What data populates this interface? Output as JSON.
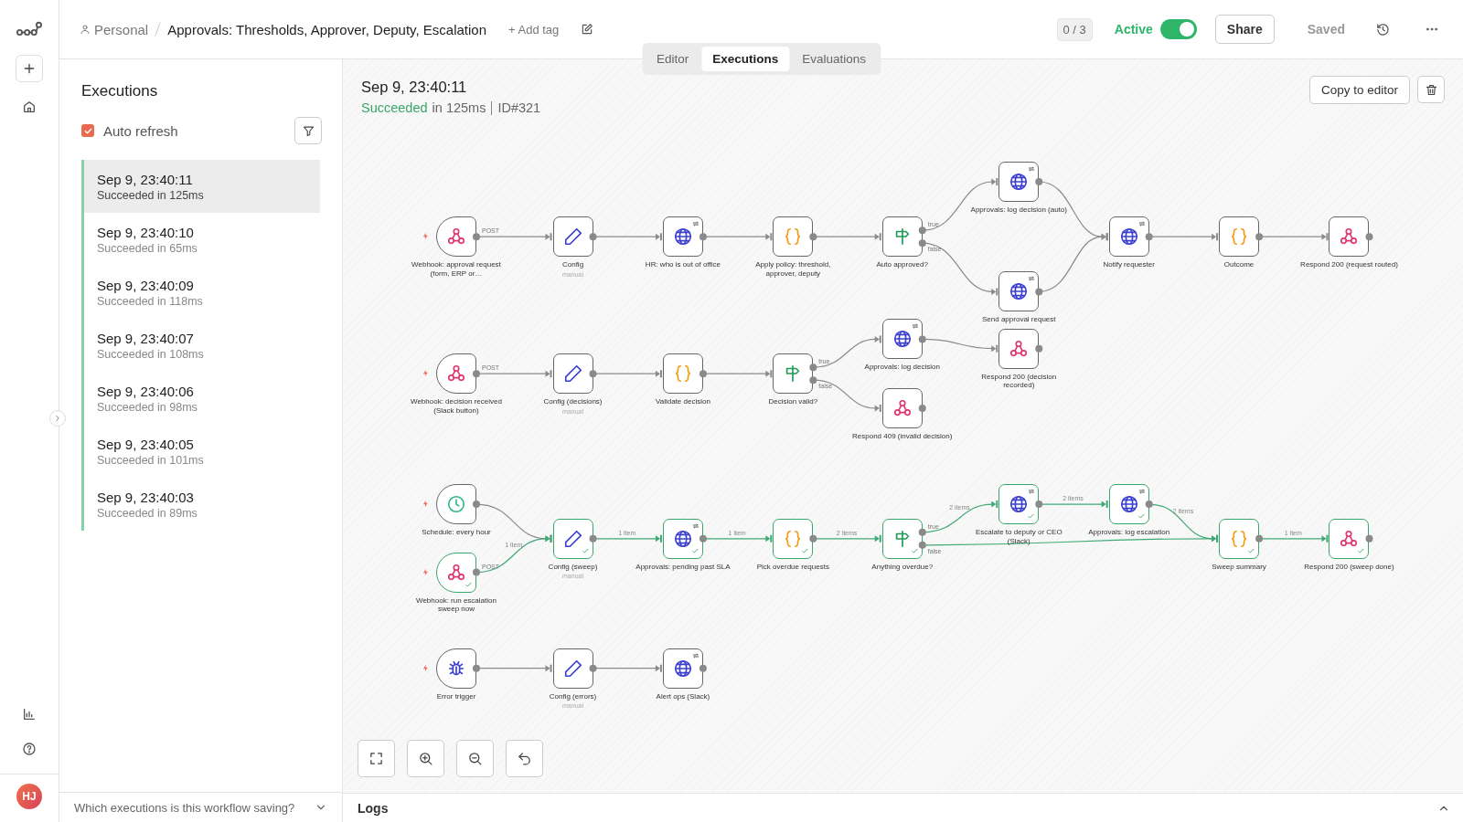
{
  "rail": {
    "avatar": "HJ"
  },
  "header": {
    "breadcrumb": "Personal",
    "title": "Approvals: Thresholds, Approver, Deputy, Escalation",
    "add_tag": "+ Add tag",
    "counter": "0 / 3",
    "active_label": "Active",
    "active": true,
    "share": "Share",
    "saved": "Saved"
  },
  "tabs": [
    {
      "label": "Editor",
      "selected": false
    },
    {
      "label": "Executions",
      "selected": true
    },
    {
      "label": "Evaluations",
      "selected": false
    }
  ],
  "sidebar": {
    "title": "Executions",
    "auto_refresh": {
      "label": "Auto refresh",
      "checked": true
    },
    "executions": [
      {
        "time": "Sep 9, 23:40:11",
        "status": "Succeeded in 125ms",
        "selected": true
      },
      {
        "time": "Sep 9, 23:40:10",
        "status": "Succeeded in 65ms",
        "selected": false
      },
      {
        "time": "Sep 9, 23:40:09",
        "status": "Succeeded in 118ms",
        "selected": false
      },
      {
        "time": "Sep 9, 23:40:07",
        "status": "Succeeded in 108ms",
        "selected": false
      },
      {
        "time": "Sep 9, 23:40:06",
        "status": "Succeeded in 98ms",
        "selected": false
      },
      {
        "time": "Sep 9, 23:40:05",
        "status": "Succeeded in 101ms",
        "selected": false
      },
      {
        "time": "Sep 9, 23:40:03",
        "status": "Succeeded in 89ms",
        "selected": false
      }
    ],
    "footer": "Which executions is this workflow saving?"
  },
  "execution": {
    "time": "Sep 9, 23:40:11",
    "status": "Succeeded",
    "duration": "in 125ms",
    "id": "ID#321",
    "copy_button": "Copy to editor"
  },
  "canvas": {
    "nodes": [
      {
        "name": "Webhook: approval request (form, ERP or…",
        "kind": "webhook",
        "trigger": true,
        "outputs": [
          {
            "label": "POST"
          }
        ],
        "executed": false
      },
      {
        "name": "Config",
        "subtitle": "manual",
        "kind": "set",
        "trigger": false,
        "executed": false
      },
      {
        "name": "HR: who is out of office",
        "kind": "http",
        "trigger": false,
        "executed": false
      },
      {
        "name": "Apply policy: threshold, approver, deputy",
        "kind": "code",
        "trigger": false,
        "executed": false
      },
      {
        "name": "Auto approved?",
        "kind": "if",
        "trigger": false,
        "outputs": [
          {
            "label": "true"
          },
          {
            "label": "false"
          }
        ],
        "executed": false
      },
      {
        "name": "Approvals: log decision (auto)",
        "kind": "http",
        "trigger": false,
        "executed": false
      },
      {
        "name": "Send approval request",
        "kind": "http",
        "trigger": false,
        "executed": false
      },
      {
        "name": "Notify requester",
        "kind": "http",
        "trigger": false,
        "executed": false
      },
      {
        "name": "Outcome",
        "kind": "code",
        "trigger": false,
        "executed": false
      },
      {
        "name": "Respond 200 (request routed)",
        "kind": "webhook",
        "trigger": false,
        "executed": false
      },
      {
        "name": "Webhook: decision received (Slack button)",
        "kind": "webhook",
        "trigger": true,
        "outputs": [
          {
            "label": "POST"
          }
        ],
        "executed": false
      },
      {
        "name": "Config (decisions)",
        "subtitle": "manual",
        "kind": "set",
        "trigger": false,
        "executed": false
      },
      {
        "name": "Validate decision",
        "kind": "code",
        "trigger": false,
        "executed": false
      },
      {
        "name": "Decision valid?",
        "kind": "if",
        "trigger": false,
        "outputs": [
          {
            "label": "true"
          },
          {
            "label": "false"
          }
        ],
        "executed": false
      },
      {
        "name": "Approvals: log decision",
        "kind": "http",
        "trigger": false,
        "executed": false
      },
      {
        "name": "Respond 200 (decision recorded)",
        "kind": "webhook",
        "trigger": false,
        "executed": false
      },
      {
        "name": "Respond 409 (invalid decision)",
        "kind": "webhook",
        "trigger": false,
        "executed": false
      },
      {
        "name": "Schedule: every hour",
        "kind": "schedule",
        "trigger": true,
        "executed": false
      },
      {
        "name": "Webhook: run escalation sweep now",
        "kind": "webhook",
        "trigger": true,
        "outputs": [
          {
            "label": "POST",
            "items": "1 item"
          }
        ],
        "executed": true
      },
      {
        "name": "Config (sweep)",
        "subtitle": "manual",
        "kind": "set",
        "trigger": false,
        "outputs": [
          {
            "items": "1 item"
          }
        ],
        "executed": true
      },
      {
        "name": "Approvals: pending past SLA",
        "kind": "http",
        "trigger": false,
        "outputs": [
          {
            "items": "1 item"
          }
        ],
        "executed": true
      },
      {
        "name": "Pick overdue requests",
        "kind": "code",
        "trigger": false,
        "outputs": [
          {
            "items": "2 items"
          }
        ],
        "executed": true
      },
      {
        "name": "Anything overdue?",
        "kind": "if",
        "trigger": false,
        "outputs": [
          {
            "label": "true",
            "items": "2 items"
          },
          {
            "label": "false"
          }
        ],
        "executed": true
      },
      {
        "name": "Escalate to deputy or CEO (Slack)",
        "kind": "http",
        "trigger": false,
        "outputs": [
          {
            "items": "2 items"
          }
        ],
        "executed": true
      },
      {
        "name": "Approvals: log escalation",
        "kind": "http",
        "trigger": false,
        "outputs": [
          {
            "items": "2 items"
          }
        ],
        "executed": true
      },
      {
        "name": "Sweep summary",
        "kind": "code",
        "trigger": false,
        "outputs": [
          {
            "items": "1 item"
          }
        ],
        "executed": true
      },
      {
        "name": "Respond 200 (sweep done)",
        "kind": "webhook",
        "trigger": false,
        "executed": true
      },
      {
        "name": "Error trigger",
        "kind": "error",
        "trigger": true,
        "executed": false
      },
      {
        "name": "Config (errors)",
        "subtitle": "manual",
        "kind": "set",
        "trigger": false,
        "executed": false
      },
      {
        "name": "Alert ops (Slack)",
        "kind": "http",
        "trigger": false,
        "executed": false
      }
    ]
  },
  "logs": {
    "title": "Logs"
  }
}
